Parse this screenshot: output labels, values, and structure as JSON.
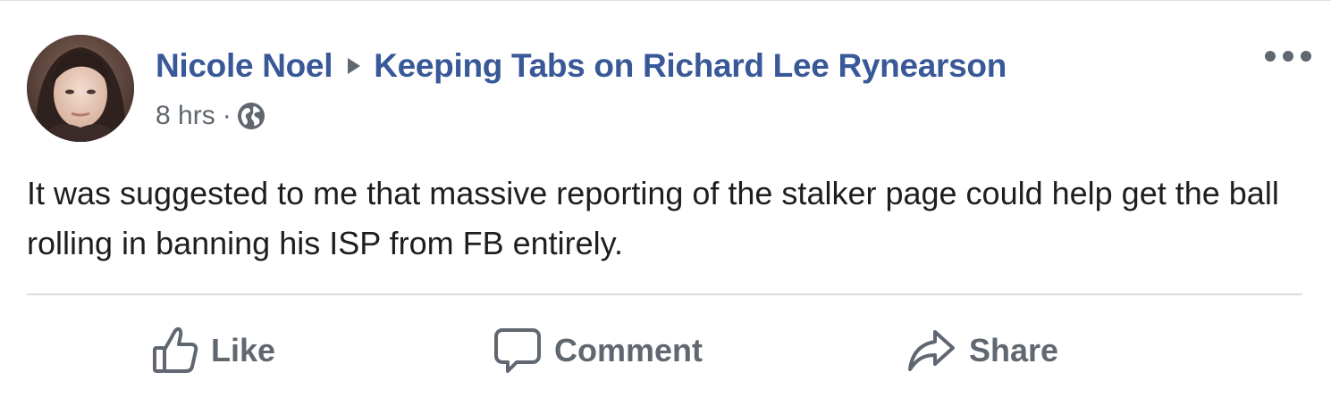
{
  "post": {
    "author": "Nicole Noel",
    "group": "Keeping Tabs on Richard Lee Rynearson",
    "timestamp": "8 hrs",
    "separator": "·",
    "privacy_icon": "globe-icon",
    "text": "It was suggested to me that massive reporting of the stalker page could help get the ball rolling in banning his ISP from FB entirely."
  },
  "actions": {
    "like": "Like",
    "comment": "Comment",
    "share": "Share"
  },
  "icons": {
    "more": "more-options-icon",
    "arrow": "triangle-right-icon",
    "like": "thumbs-up-icon",
    "comment": "speech-bubble-icon",
    "share": "share-arrow-icon"
  },
  "colors": {
    "link": "#385898",
    "text": "#1c1e21",
    "secondary": "#606770",
    "divider": "#dadde1"
  }
}
